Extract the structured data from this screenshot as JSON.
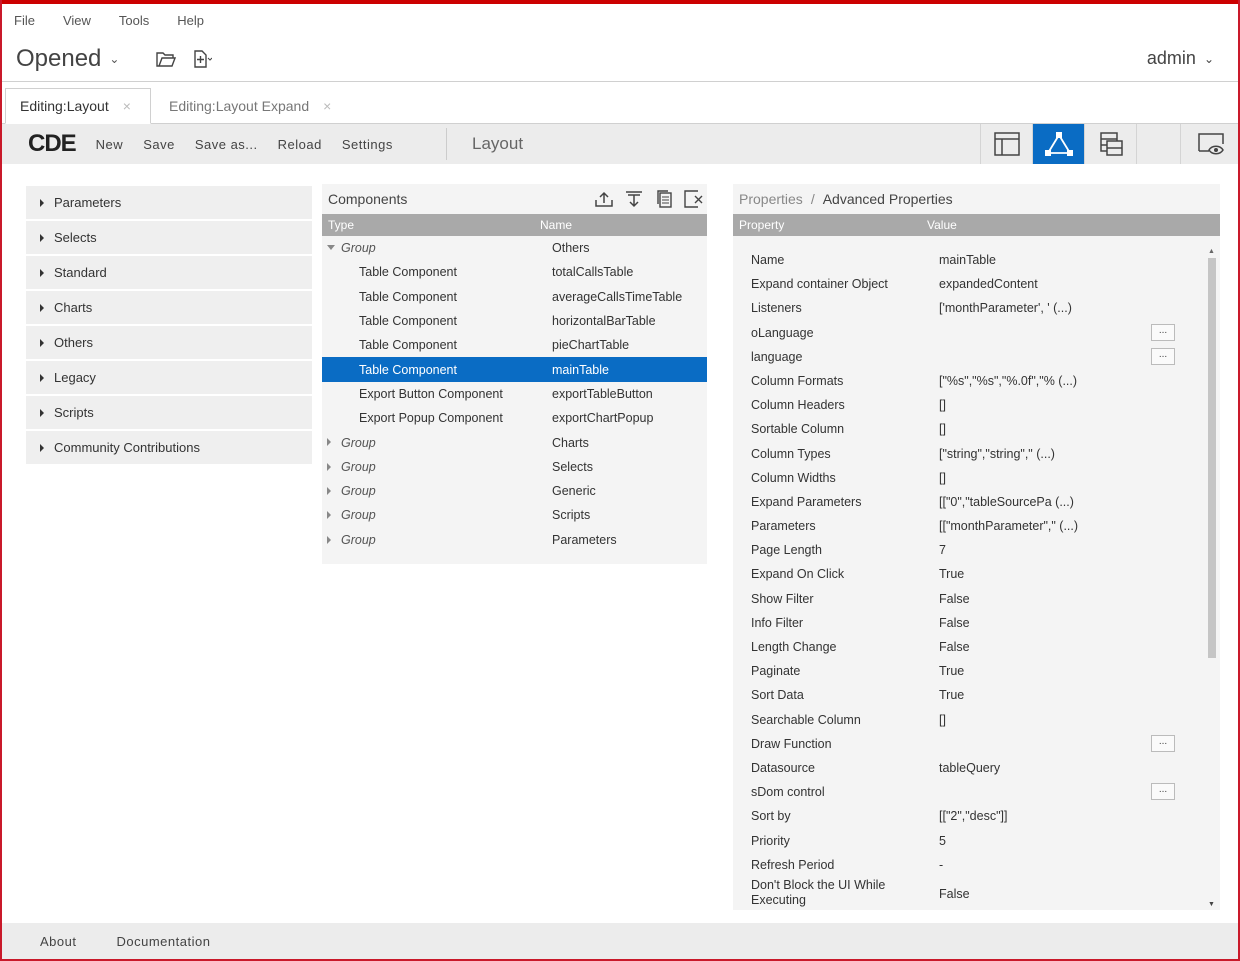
{
  "menu": [
    "File",
    "View",
    "Tools",
    "Help"
  ],
  "header": {
    "opened_label": "Opened",
    "user": "admin"
  },
  "tabs": [
    {
      "label": "Editing:Layout",
      "active": true
    },
    {
      "label": "Editing:Layout Expand",
      "active": false
    }
  ],
  "toolbar": {
    "logo": "CDE",
    "buttons": [
      "New",
      "Save",
      "Save as...",
      "Reload",
      "Settings"
    ],
    "title": "Layout",
    "accent": "#0a6cc4"
  },
  "left_panel": [
    "Parameters",
    "Selects",
    "Standard",
    "Charts",
    "Others",
    "Legacy",
    "Scripts",
    "Community Contributions"
  ],
  "components": {
    "title": "Components",
    "col_type": "Type",
    "col_name": "Name",
    "rows": [
      {
        "type": "Group",
        "name": "Others",
        "group": true,
        "expanded": true
      },
      {
        "type": "Table Component",
        "name": "totalCallsTable"
      },
      {
        "type": "Table Component",
        "name": "averageCallsTimeTable"
      },
      {
        "type": "Table Component",
        "name": "horizontalBarTable"
      },
      {
        "type": "Table Component",
        "name": "pieChartTable"
      },
      {
        "type": "Table Component",
        "name": "mainTable",
        "selected": true
      },
      {
        "type": "Export Button Component",
        "name": "exportTableButton"
      },
      {
        "type": "Export Popup Component",
        "name": "exportChartPopup"
      },
      {
        "type": "Group",
        "name": "Charts",
        "group": true
      },
      {
        "type": "Group",
        "name": "Selects",
        "group": true
      },
      {
        "type": "Group",
        "name": "Generic",
        "group": true
      },
      {
        "type": "Group",
        "name": "Scripts",
        "group": true
      },
      {
        "type": "Group",
        "name": "Parameters",
        "group": true
      }
    ]
  },
  "properties": {
    "crumb1": "Properties",
    "crumb2": "Advanced Properties",
    "col_prop": "Property",
    "col_value": "Value",
    "rows": [
      {
        "k": "Name",
        "v": "mainTable"
      },
      {
        "k": "Expand container Object",
        "v": "expandedContent"
      },
      {
        "k": "Listeners",
        "v": "['monthParameter', ' (...)"
      },
      {
        "k": "oLanguage",
        "v": "",
        "btn": "..."
      },
      {
        "k": "language",
        "v": "",
        "btn": "..."
      },
      {
        "k": "Column Formats",
        "v": "[\"%s\",\"%s\",\"%.0f\",\"% (...)"
      },
      {
        "k": "Column Headers",
        "v": "[]"
      },
      {
        "k": "Sortable Column",
        "v": "[]"
      },
      {
        "k": "Column Types",
        "v": "[\"string\",\"string\",\" (...)"
      },
      {
        "k": "Column Widths",
        "v": "[]"
      },
      {
        "k": "Expand Parameters",
        "v": "[[\"0\",\"tableSourcePa (...)"
      },
      {
        "k": "Parameters",
        "v": "[[\"monthParameter\",\" (...)"
      },
      {
        "k": "Page Length",
        "v": "7"
      },
      {
        "k": "Expand On Click",
        "v": "True"
      },
      {
        "k": "Show Filter",
        "v": "False"
      },
      {
        "k": "Info Filter",
        "v": "False"
      },
      {
        "k": "Length Change",
        "v": "False"
      },
      {
        "k": "Paginate",
        "v": "True"
      },
      {
        "k": "Sort Data",
        "v": "True"
      },
      {
        "k": "Searchable Column",
        "v": "[]"
      },
      {
        "k": "Draw Function",
        "v": "",
        "btn": "..."
      },
      {
        "k": "Datasource",
        "v": "tableQuery"
      },
      {
        "k": "sDom control",
        "v": "",
        "btn": "..."
      },
      {
        "k": "Sort by",
        "v": "[[\"2\",\"desc\"]]"
      },
      {
        "k": "Priority",
        "v": "5"
      },
      {
        "k": "Refresh Period",
        "v": "-"
      },
      {
        "k": "Don't Block the UI While Executing",
        "v": "False"
      }
    ]
  },
  "footer": [
    "About",
    "Documentation"
  ]
}
